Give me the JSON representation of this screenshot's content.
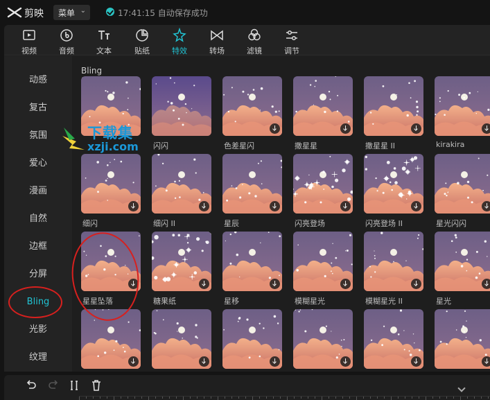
{
  "app": {
    "name": "剪映",
    "menu_label": "菜单",
    "save_status": "17:41:15 自动保存成功"
  },
  "toolbar": [
    {
      "id": "video",
      "label": "视频",
      "icon": "video-icon"
    },
    {
      "id": "audio",
      "label": "音频",
      "icon": "audio-icon"
    },
    {
      "id": "text",
      "label": "文本",
      "icon": "text-icon"
    },
    {
      "id": "sticker",
      "label": "贴纸",
      "icon": "sticker-icon"
    },
    {
      "id": "effects",
      "label": "特效",
      "icon": "effects-icon",
      "active": true
    },
    {
      "id": "transition",
      "label": "转场",
      "icon": "transition-icon"
    },
    {
      "id": "filter",
      "label": "滤镜",
      "icon": "filter-icon"
    },
    {
      "id": "adjust",
      "label": "调节",
      "icon": "adjust-icon"
    }
  ],
  "categories": [
    "动感",
    "复古",
    "氛围",
    "爱心",
    "漫画",
    "自然",
    "边框",
    "分屏",
    "Bling",
    "光影",
    "纹理"
  ],
  "active_category": "Bling",
  "section_title": "Bling",
  "effects": [
    [
      "",
      "闪闪",
      "色差星闪",
      "撒星星",
      "撒星星 II",
      "kirakira"
    ],
    [
      "细闪",
      "细闪 II",
      "星辰",
      "闪亮登场",
      "闪亮登场 II",
      "星光闪闪"
    ],
    [
      "星星坠落",
      "糖果纸",
      "星移",
      "模糊星光",
      "模糊星光 II",
      "星光"
    ],
    [
      "",
      "",
      "",
      "",
      "",
      ""
    ]
  ],
  "watermark": {
    "line1": "下载集",
    "line2": "xzji.com"
  },
  "colors": {
    "accent": "#21c3d3",
    "annotation": "#d8201e",
    "watermark": "#1b98d8"
  }
}
